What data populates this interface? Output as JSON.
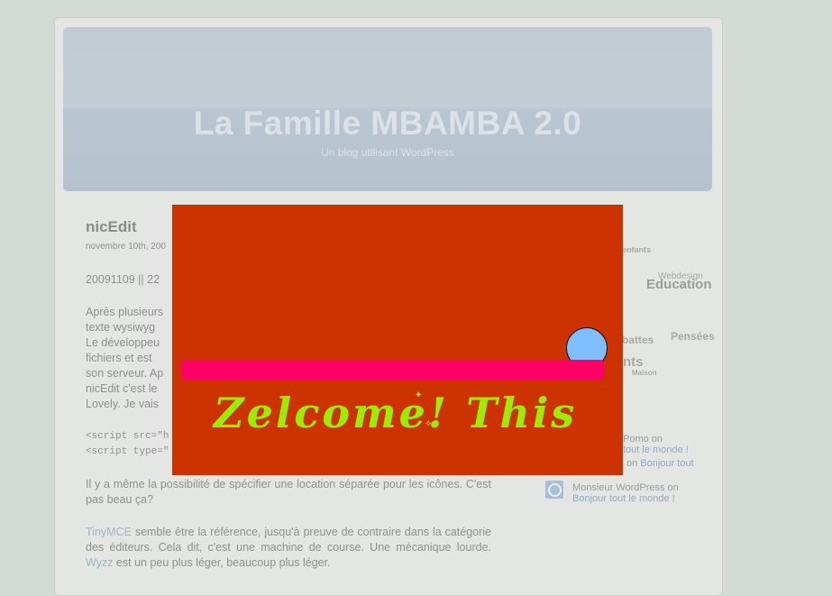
{
  "blog": {
    "title": "La Famille MBAMBA 2.0",
    "tagline": "Un blog utilisant WordPress"
  },
  "post": {
    "title": "nicEdit",
    "date": "novembre 10th, 200",
    "line_id": "20091109 || 22",
    "frag1": "Après plusieurs",
    "frag2": "texte wysiwyg",
    "frag3": "Le développeu",
    "frag4": "fichiers et est",
    "frag5": "son serveur. Ap",
    "frag6": "nicEdit c'est le",
    "frag7": "Lovely. Je vais",
    "code1": "<script src=\"h",
    "code2": "<script type=\"",
    "para_icons": "Il y a même la possibilité de spécifier une location séparée pour les icônes. C'est pas beau ça?",
    "tinymce_link": "TinyMCE",
    "tinymce_text": " semble être la référence, jusqu'à preuve de contraire dans la catégorie des éditeurs. Cela dit, c'est une machine de course. Une mécanique lourde. ",
    "wyzz_link": "Wyzz",
    "wyzz_text": " est un peu plus léger, beaucoup plus léger."
  },
  "sidebar": {
    "tags": {
      "enfants": "enfants",
      "webdesign": "Webdesign",
      "education": "Education",
      "battes": "battes",
      "pensees": "Pensées",
      "nts": "nts",
      "maison": "Maison"
    },
    "comments": {
      "c1_tail": "Pomo on",
      "c1_link": "tout le monde !",
      "c2_link": "Bonjour tout",
      "c2_pre": "on ",
      "c3_author": "Monsieur WordPress on",
      "c3_link": "Bonjour tout le monde !"
    }
  },
  "game": {
    "text": "Zelcome! This",
    "colors": {
      "background": "#cc3300",
      "ball": "#80bfff",
      "paddle": "#ff0066",
      "text": "#99ee00"
    }
  }
}
